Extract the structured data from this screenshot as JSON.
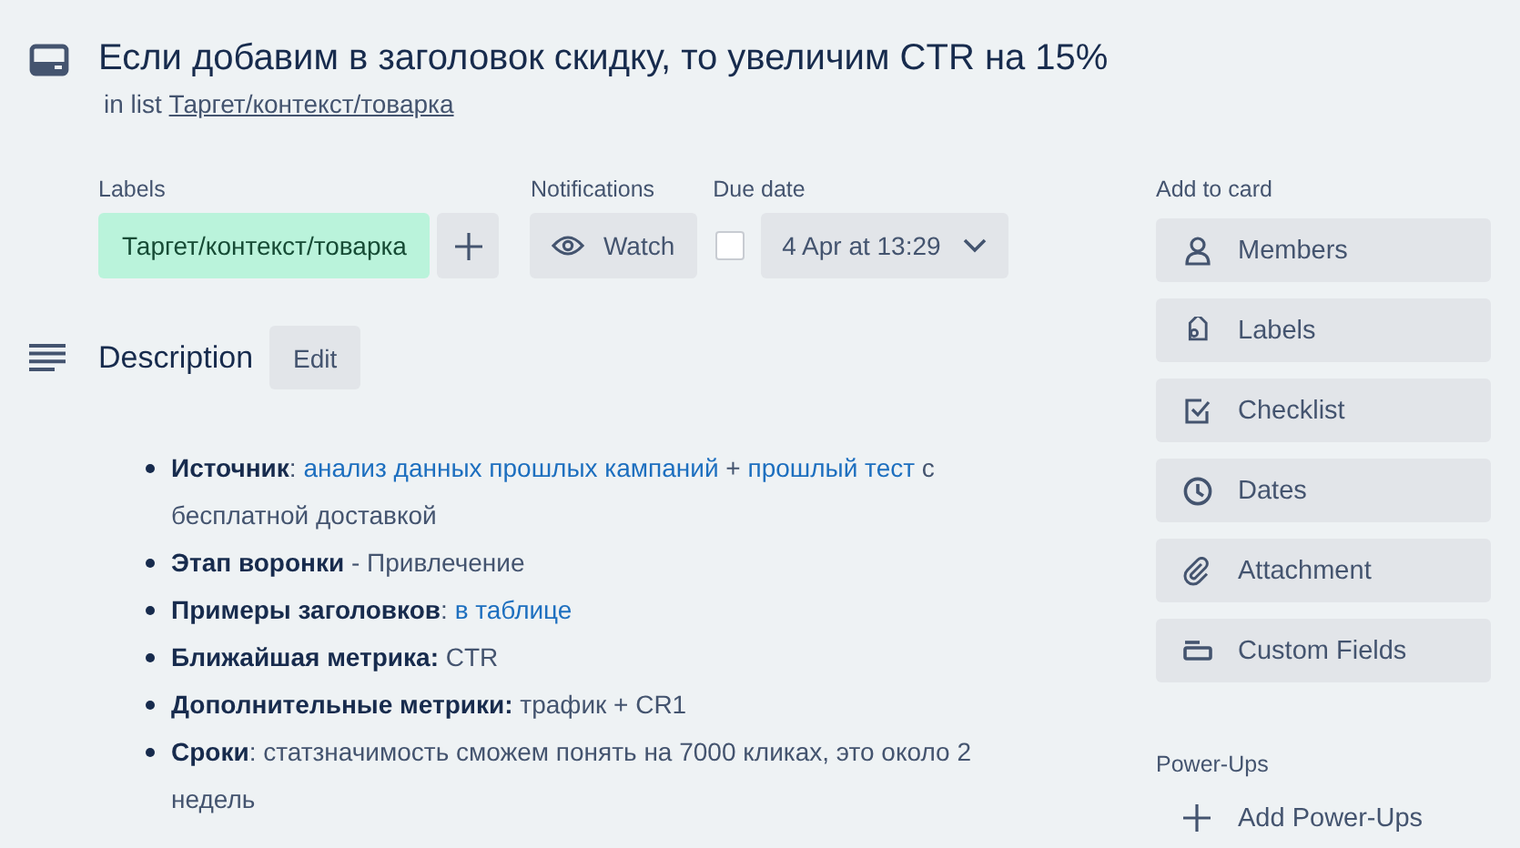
{
  "card": {
    "title": "Если добавим в заголовок скидку, то увеличим CTR на 15%",
    "list_prefix": "in list",
    "list_name": "Таргет/контекст/товарка"
  },
  "labels": {
    "heading": "Labels",
    "items": [
      {
        "text": "Таргет/контекст/товарка",
        "color": "#baf3db"
      }
    ]
  },
  "notifications": {
    "heading": "Notifications",
    "button": "Watch"
  },
  "due_date": {
    "heading": "Due date",
    "checked": false,
    "value": "4 Apr at 13:29"
  },
  "description": {
    "heading": "Description",
    "edit": "Edit",
    "items": [
      [
        {
          "kind": "bold",
          "text": "Источник"
        },
        {
          "kind": "plain",
          "text": ": "
        },
        {
          "kind": "link",
          "text": "анализ данных прошлых кампаний"
        },
        {
          "kind": "plain",
          "text": " + "
        },
        {
          "kind": "link",
          "text": "прошлый тест"
        },
        {
          "kind": "plain",
          "text": " с бесплатной доставкой"
        }
      ],
      [
        {
          "kind": "bold",
          "text": "Этап воронки"
        },
        {
          "kind": "plain",
          "text": " - Привлечение"
        }
      ],
      [
        {
          "kind": "bold",
          "text": "Примеры заголовков"
        },
        {
          "kind": "plain",
          "text": ": "
        },
        {
          "kind": "link",
          "text": "в таблице"
        }
      ],
      [
        {
          "kind": "bold",
          "text": "Ближайшая метрика:"
        },
        {
          "kind": "plain",
          "text": " CTR"
        }
      ],
      [
        {
          "kind": "bold",
          "text": "Дополнительные метрики:"
        },
        {
          "kind": "plain",
          "text": " трафик + CR1"
        }
      ],
      [
        {
          "kind": "bold",
          "text": "Сроки"
        },
        {
          "kind": "plain",
          "text": ": статзначимость сможем понять на 7000 кликах, это около 2 недель"
        }
      ]
    ]
  },
  "sidebar": {
    "add_heading": "Add to card",
    "buttons": [
      {
        "label": "Members"
      },
      {
        "label": "Labels"
      },
      {
        "label": "Checklist"
      },
      {
        "label": "Dates"
      },
      {
        "label": "Attachment"
      },
      {
        "label": "Custom Fields"
      }
    ],
    "powerups_heading": "Power-Ups",
    "add_powerups": "Add Power-Ups"
  }
}
